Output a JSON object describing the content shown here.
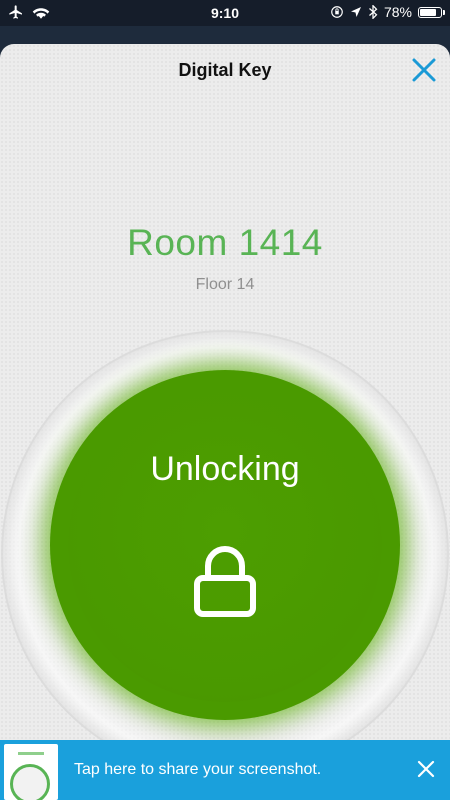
{
  "status_bar": {
    "time": "9:10",
    "battery_text": "78%",
    "battery_level": 0.78,
    "icons": [
      "airplane-icon",
      "wifi-icon",
      "orientation-lock-icon",
      "location-arrow-icon",
      "bluetooth-icon",
      "battery-icon"
    ]
  },
  "header": {
    "title": "Digital Key",
    "close_icon": "close-icon"
  },
  "room": {
    "title": "Room 1414",
    "floor": "Floor 14"
  },
  "unlock_button": {
    "label": "Unlocking",
    "icon": "lock-icon"
  },
  "share_banner": {
    "text": "Tap here to share your screenshot.",
    "close_icon": "close-icon"
  },
  "colors": {
    "room_title": "#59b455",
    "unlock_green": "#4a9a00",
    "close_blue": "#1a9ad6",
    "banner_blue": "#1aa0dc"
  }
}
